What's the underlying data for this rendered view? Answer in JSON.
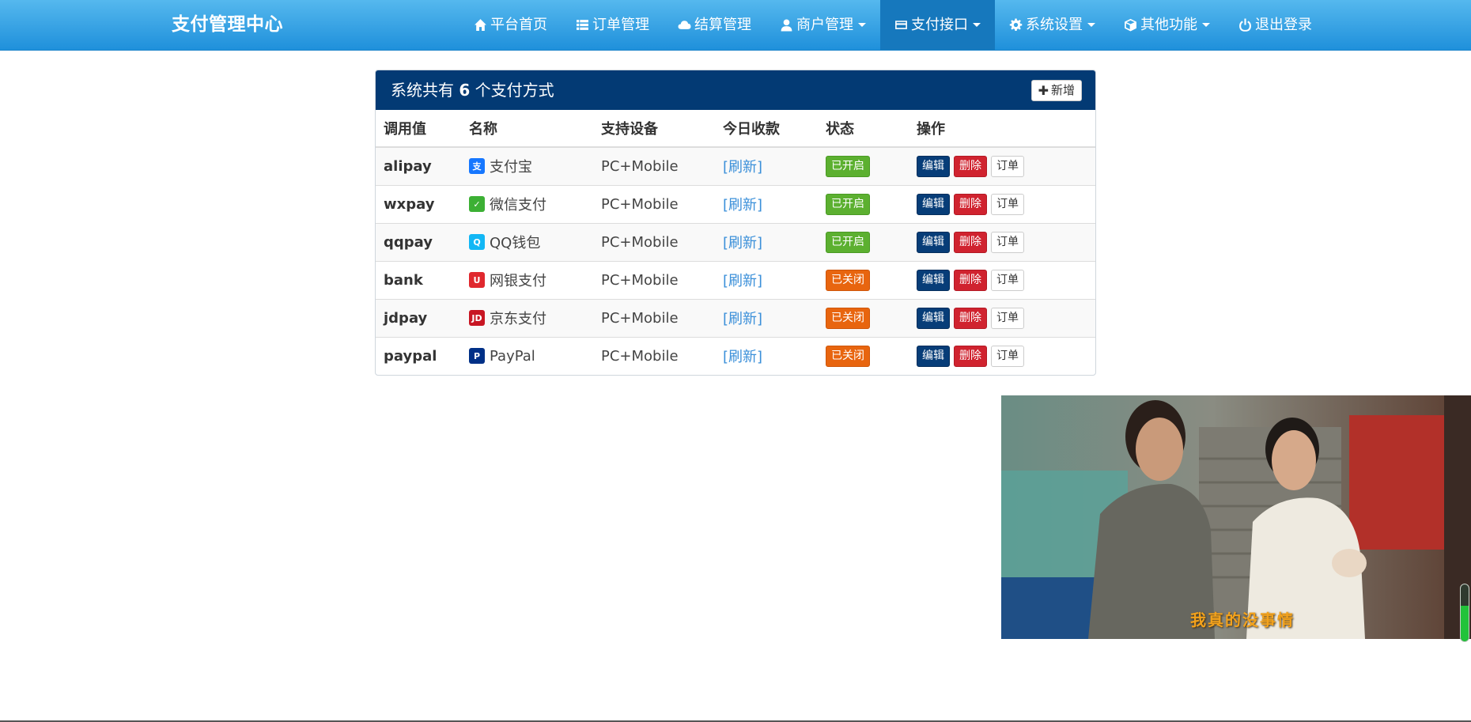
{
  "navbar": {
    "brand": "支付管理中心",
    "items": [
      {
        "label": "平台首页",
        "icon": "home-icon",
        "dropdown": false,
        "active": false
      },
      {
        "label": "订单管理",
        "icon": "list-icon",
        "dropdown": false,
        "active": false
      },
      {
        "label": "结算管理",
        "icon": "cloud-icon",
        "dropdown": false,
        "active": false
      },
      {
        "label": "商户管理",
        "icon": "user-icon",
        "dropdown": true,
        "active": false
      },
      {
        "label": "支付接口",
        "icon": "credit-card-icon",
        "dropdown": true,
        "active": true
      },
      {
        "label": "系统设置",
        "icon": "gear-icon",
        "dropdown": true,
        "active": false
      },
      {
        "label": "其他功能",
        "icon": "cube-icon",
        "dropdown": true,
        "active": false
      },
      {
        "label": "退出登录",
        "icon": "power-icon",
        "dropdown": false,
        "active": false
      }
    ]
  },
  "panel": {
    "title_prefix": "系统共有",
    "count": "6",
    "title_suffix": "个支付方式",
    "add_label": "新增"
  },
  "table": {
    "headers": [
      "调用值",
      "名称",
      "支持设备",
      "今日收款",
      "状态",
      "操作"
    ],
    "rows": [
      {
        "key": "alipay",
        "name": "支付宝",
        "icon": "alipay-icon",
        "icon_color": "#1677ff",
        "device": "PC+Mobile",
        "income": "[刷新]",
        "status": "已开启",
        "status_on": true
      },
      {
        "key": "wxpay",
        "name": "微信支付",
        "icon": "wechat-pay-icon",
        "icon_color": "#3cb034",
        "device": "PC+Mobile",
        "income": "[刷新]",
        "status": "已开启",
        "status_on": true
      },
      {
        "key": "qqpay",
        "name": "QQ钱包",
        "icon": "qq-wallet-icon",
        "icon_color": "#12b7f5",
        "device": "PC+Mobile",
        "income": "[刷新]",
        "status": "已开启",
        "status_on": true
      },
      {
        "key": "bank",
        "name": "网银支付",
        "icon": "unionpay-icon",
        "icon_color": "#e0282e",
        "device": "PC+Mobile",
        "income": "[刷新]",
        "status": "已关闭",
        "status_on": false
      },
      {
        "key": "jdpay",
        "name": "京东支付",
        "icon": "jd-icon",
        "icon_color": "#c81623",
        "device": "PC+Mobile",
        "income": "[刷新]",
        "status": "已关闭",
        "status_on": false
      },
      {
        "key": "paypal",
        "name": "PayPal",
        "icon": "paypal-icon",
        "icon_color": "#003087",
        "device": "PC+Mobile",
        "income": "[刷新]",
        "status": "已关闭",
        "status_on": false
      }
    ],
    "actions": {
      "edit": "编辑",
      "delete": "删除",
      "orders": "订单"
    }
  },
  "video": {
    "subtitle": "我真的没事情",
    "volume_level": 0.62
  }
}
